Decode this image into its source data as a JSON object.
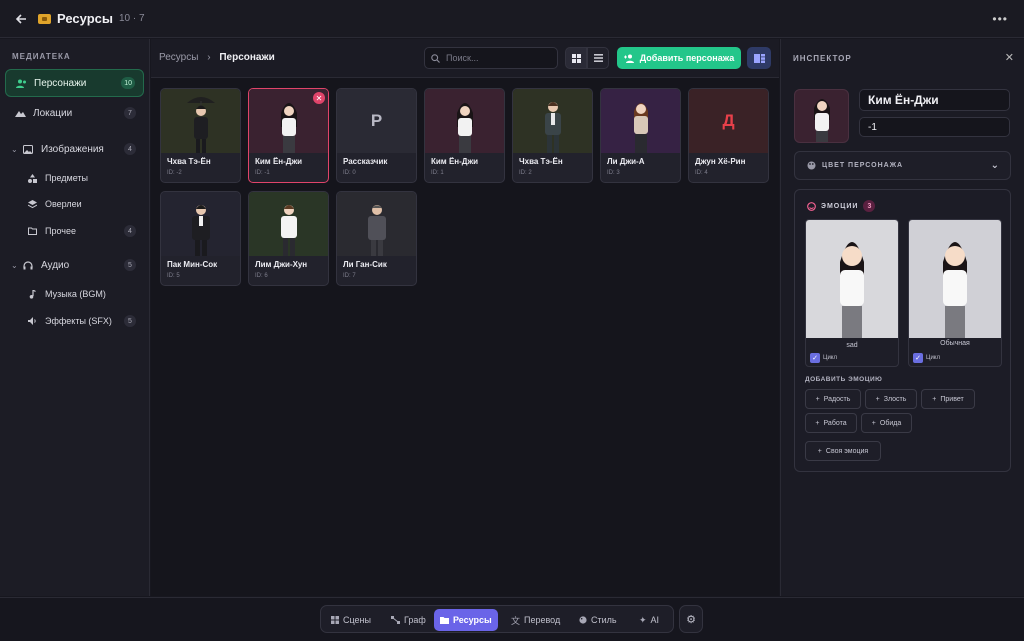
{
  "header": {
    "title": "Ресурсы",
    "counts": "10 · 7"
  },
  "sidebar": {
    "section": "МЕДИАТЕКА",
    "items": [
      {
        "label": "Персонажи",
        "count": "10"
      },
      {
        "label": "Локации",
        "count": "7"
      },
      {
        "label": "Изображения",
        "count": "4"
      },
      {
        "label": "Предметы",
        "count": ""
      },
      {
        "label": "Оверлеи",
        "count": ""
      },
      {
        "label": "Прочее",
        "count": "4"
      },
      {
        "label": "Аудио",
        "count": "5"
      },
      {
        "label": "Музыка (BGM)",
        "count": ""
      },
      {
        "label": "Эффекты (SFX)",
        "count": "5"
      }
    ]
  },
  "toolbar": {
    "breadcrumb_root": "Ресурсы",
    "breadcrumb_current": "Персонажи",
    "search_placeholder": "Поиск...",
    "add_label": "Добавить персонажа"
  },
  "cards": [
    {
      "name": "Чхва Тэ-Ён",
      "id": "ID: -2"
    },
    {
      "name": "Ким Ён-Джи",
      "id": "ID: -1"
    },
    {
      "name": "Рассказчик",
      "id": "ID: 0",
      "letter": "Р"
    },
    {
      "name": "Ким Ён-Джи",
      "id": "ID: 1"
    },
    {
      "name": "Чхва Тэ-Ён",
      "id": "ID: 2"
    },
    {
      "name": "Ли Джи-А",
      "id": "ID: 3"
    },
    {
      "name": "Джун Хё-Рин",
      "id": "ID: 4",
      "letter": "Д"
    },
    {
      "name": "Пак Мин-Сок",
      "id": "ID: 5"
    },
    {
      "name": "Лим Джи-Хун",
      "id": "ID: 6"
    },
    {
      "name": "Ли Ган-Сик",
      "id": "ID: 7"
    }
  ],
  "inspector": {
    "title": "ИНСПЕКТОР",
    "name": "Ким Ён-Джи",
    "id_value": "-1",
    "color_label": "ЦВЕТ ПЕРСОНАЖА",
    "emotions_label": "ЭМОЦИИ",
    "emotions_count": "3",
    "emotions": [
      {
        "name": "sad",
        "loop": "Цикл"
      },
      {
        "name": "Обычная",
        "loop": "Цикл"
      }
    ],
    "add_emotion_label": "ДОБАВИТЬ ЭМОЦИЮ",
    "presets": [
      "Радость",
      "Злость",
      "Привет",
      "Работа",
      "Обида",
      "Своя эмоция"
    ]
  },
  "dock": {
    "tabs": [
      "Сцены",
      "Граф",
      "Ресурсы",
      "Перевод",
      "Стиль",
      "AI"
    ]
  }
}
